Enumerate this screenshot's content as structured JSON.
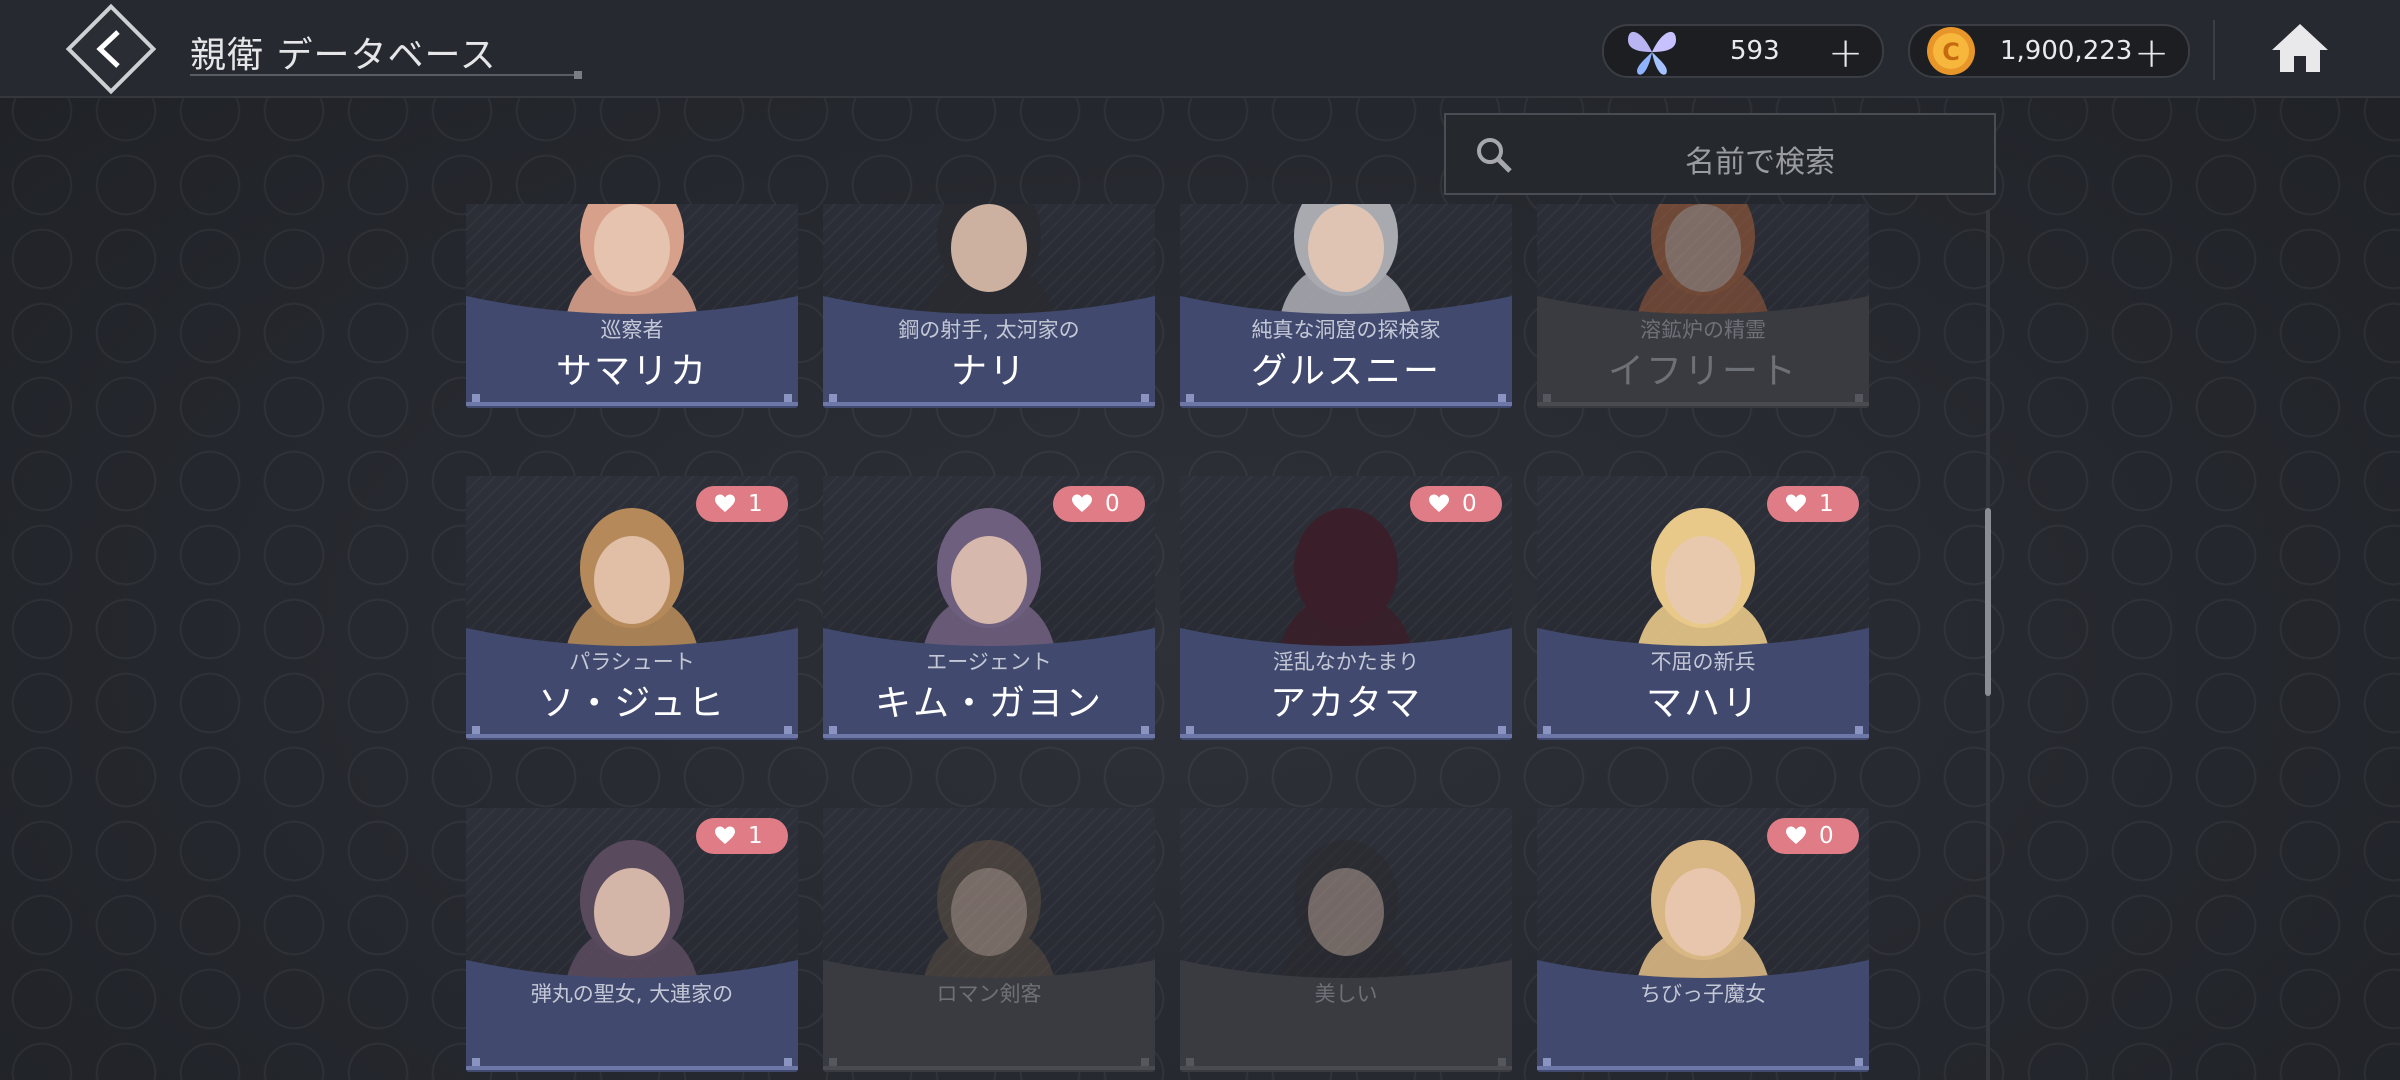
{
  "header": {
    "title": "親衛 データベース",
    "resources": [
      {
        "name": "butterfly",
        "icon": "butterfly-icon",
        "value": "593"
      },
      {
        "name": "gold",
        "icon": "gold-coin-icon",
        "value": "1,900,223"
      }
    ]
  },
  "search": {
    "placeholder": "名前で検索"
  },
  "cards": [
    {
      "subtitle": "巡察者",
      "name": "サマリカ",
      "likes": null,
      "locked": false,
      "accent": "#d7a08a"
    },
    {
      "subtitle": "鋼の射手, 太河家の",
      "name": "ナリ",
      "likes": null,
      "locked": false,
      "accent": "#2a2b31"
    },
    {
      "subtitle": "純真な洞窟の探検家",
      "name": "グルスニー",
      "likes": null,
      "locked": false,
      "accent": "#a8aab0"
    },
    {
      "subtitle": "溶鉱炉の精霊",
      "name": "イフリート",
      "likes": null,
      "locked": true,
      "accent": "#c46a3a"
    },
    {
      "subtitle": "パラシュート",
      "name": "ソ・ジュヒ",
      "likes": "1",
      "locked": false,
      "accent": "#b5895a"
    },
    {
      "subtitle": "エージェント",
      "name": "キム・ガヨン",
      "likes": "0",
      "locked": false,
      "accent": "#6f5f7e"
    },
    {
      "subtitle": "淫乱なかたまり",
      "name": "アカタマ",
      "likes": "0",
      "locked": false,
      "accent": "#3a1f2a"
    },
    {
      "subtitle": "不屈の新兵",
      "name": "マハリ",
      "likes": "1",
      "locked": false,
      "accent": "#e8c98a"
    },
    {
      "subtitle": "弾丸の聖女, 大連家の",
      "name": "",
      "likes": "1",
      "locked": false,
      "accent": "#5a4a5e"
    },
    {
      "subtitle": "ロマン剣客",
      "name": "",
      "likes": null,
      "locked": true,
      "accent": "#6a5a48"
    },
    {
      "subtitle": "美しい",
      "name": "",
      "likes": null,
      "locked": true,
      "accent": "#2a2a2e"
    },
    {
      "subtitle": "ちびっ子魔女",
      "name": "",
      "likes": "0",
      "locked": false,
      "accent": "#d9b784"
    }
  ],
  "colors": {
    "panel": "#414a6e",
    "panel_dim": "#3a3b40",
    "badge": "#e07c86"
  }
}
